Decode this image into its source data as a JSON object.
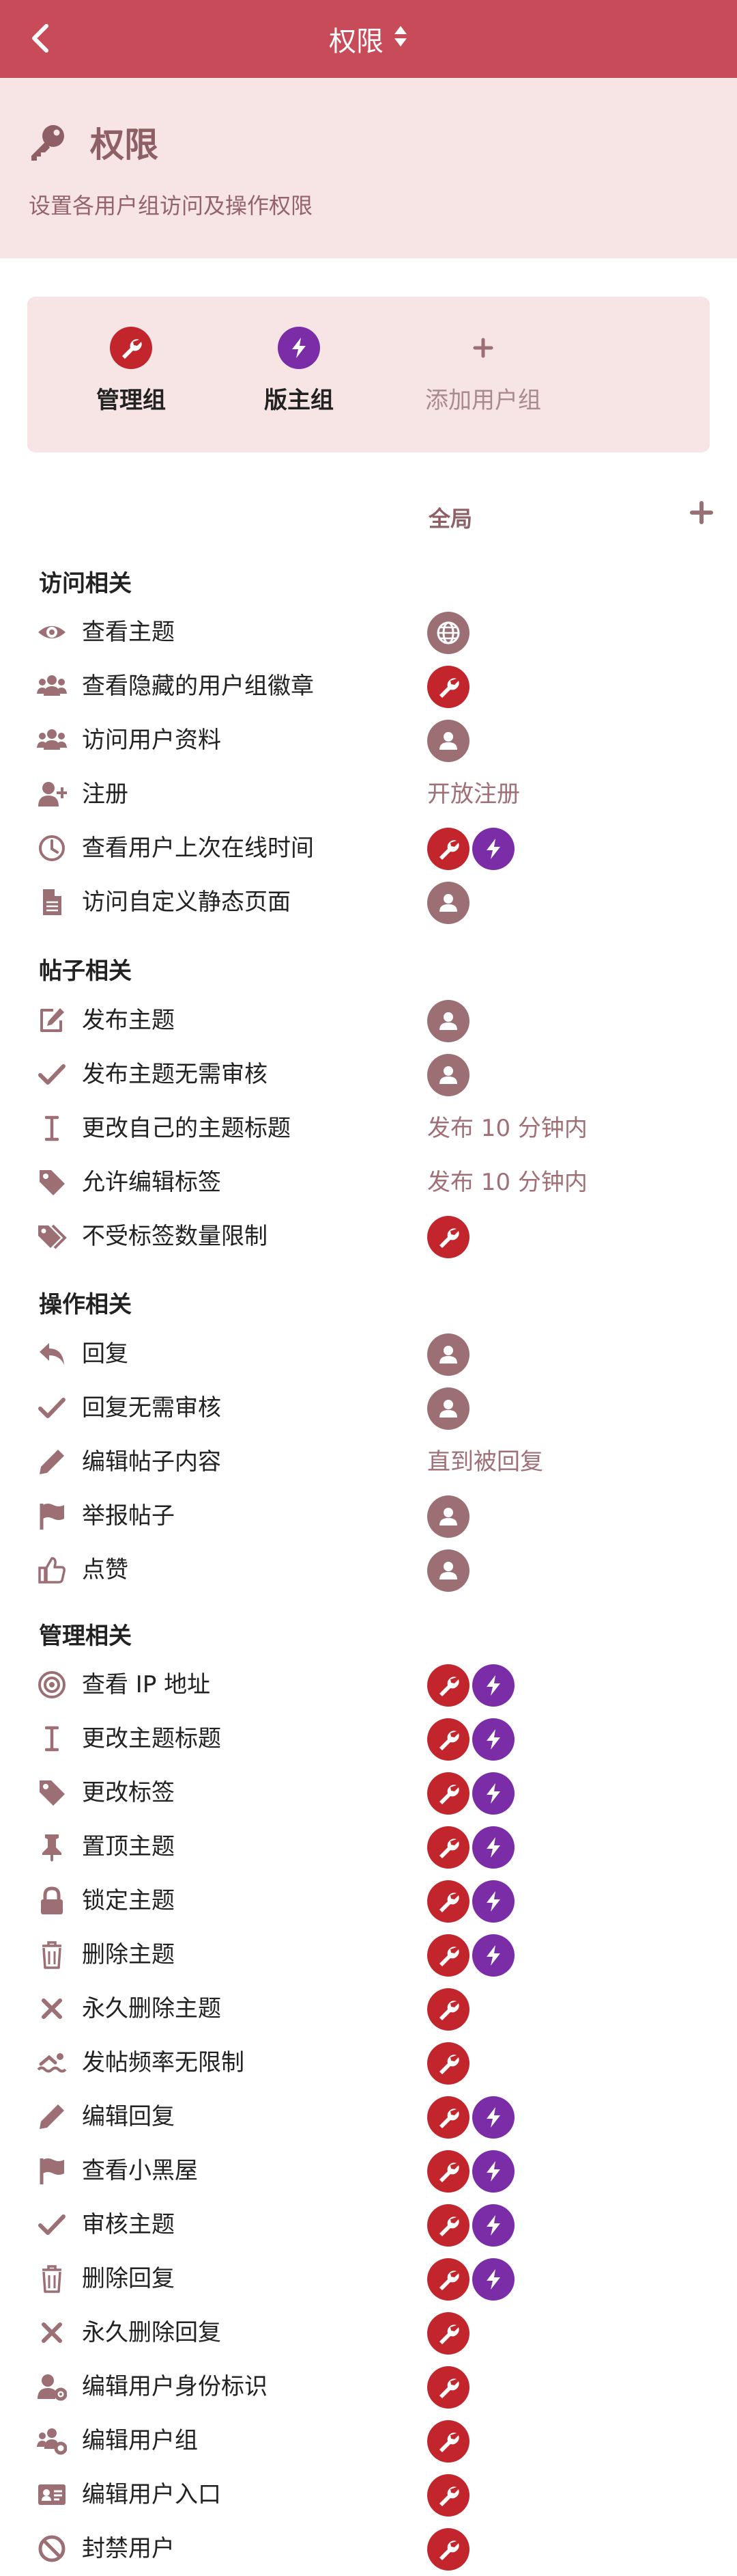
{
  "header": {
    "title": "权限"
  },
  "hero": {
    "title": "权限",
    "subtitle": "设置各用户组访问及操作权限"
  },
  "groups": [
    {
      "label": "管理组",
      "icon": "wrench-icon",
      "color": "#c2262c"
    },
    {
      "label": "版主组",
      "icon": "bolt-icon",
      "color": "#7b2da8"
    },
    {
      "label": "添加用户组",
      "icon": "plus-icon"
    }
  ],
  "column_header": "全局",
  "sections": [
    {
      "title": "访问相关",
      "rows": [
        {
          "label": "查看主题",
          "icon": "eye-icon",
          "value": [
            "globe"
          ]
        },
        {
          "label": "查看隐藏的用户组徽章",
          "icon": "users-icon",
          "value": [
            "admin"
          ]
        },
        {
          "label": "访问用户资料",
          "icon": "users-icon",
          "value": [
            "member"
          ]
        },
        {
          "label": "注册",
          "icon": "user-plus-icon",
          "text": "开放注册"
        },
        {
          "label": "查看用户上次在线时间",
          "icon": "clock-icon",
          "value": [
            "admin",
            "mod"
          ]
        },
        {
          "label": "访问自定义静态页面",
          "icon": "file-icon",
          "value": [
            "member"
          ]
        }
      ]
    },
    {
      "title": "帖子相关",
      "rows": [
        {
          "label": "发布主题",
          "icon": "edit-icon",
          "value": [
            "member"
          ]
        },
        {
          "label": "发布主题无需审核",
          "icon": "check-icon",
          "value": [
            "member"
          ]
        },
        {
          "label": "更改自己的主题标题",
          "icon": "i-cursor-icon",
          "text": "发布 10 分钟内"
        },
        {
          "label": "允许编辑标签",
          "icon": "tag-icon",
          "text": "发布 10 分钟内"
        },
        {
          "label": "不受标签数量限制",
          "icon": "tags-icon",
          "value": [
            "admin"
          ]
        }
      ]
    },
    {
      "title": "操作相关",
      "rows": [
        {
          "label": "回复",
          "icon": "reply-icon",
          "value": [
            "member"
          ]
        },
        {
          "label": "回复无需审核",
          "icon": "check-icon",
          "value": [
            "member"
          ]
        },
        {
          "label": "编辑帖子内容",
          "icon": "pencil-icon",
          "text": "直到被回复"
        },
        {
          "label": "举报帖子",
          "icon": "flag-icon",
          "value": [
            "member"
          ]
        },
        {
          "label": "点赞",
          "icon": "thumbs-up-icon",
          "value": [
            "member"
          ]
        }
      ]
    },
    {
      "title": "管理相关",
      "rows": [
        {
          "label": "查看 IP 地址",
          "icon": "target-icon",
          "value": [
            "admin",
            "mod"
          ]
        },
        {
          "label": "更改主题标题",
          "icon": "i-cursor-icon",
          "value": [
            "admin",
            "mod"
          ]
        },
        {
          "label": "更改标签",
          "icon": "tag-icon",
          "value": [
            "admin",
            "mod"
          ]
        },
        {
          "label": "置顶主题",
          "icon": "pin-icon",
          "value": [
            "admin",
            "mod"
          ]
        },
        {
          "label": "锁定主题",
          "icon": "lock-icon",
          "value": [
            "admin",
            "mod"
          ]
        },
        {
          "label": "删除主题",
          "icon": "trash-icon",
          "value": [
            "admin",
            "mod"
          ]
        },
        {
          "label": "永久删除主题",
          "icon": "times-icon",
          "value": [
            "admin"
          ]
        },
        {
          "label": "发帖频率无限制",
          "icon": "swimmer-icon",
          "value": [
            "admin"
          ]
        },
        {
          "label": "编辑回复",
          "icon": "pencil-icon",
          "value": [
            "admin",
            "mod"
          ]
        },
        {
          "label": "查看小黑屋",
          "icon": "flag-icon",
          "value": [
            "admin",
            "mod"
          ]
        },
        {
          "label": "审核主题",
          "icon": "check-icon",
          "value": [
            "admin",
            "mod"
          ]
        },
        {
          "label": "删除回复",
          "icon": "trash-icon",
          "value": [
            "admin",
            "mod"
          ]
        },
        {
          "label": "永久删除回复",
          "icon": "times-icon",
          "value": [
            "admin"
          ]
        },
        {
          "label": "编辑用户身份标识",
          "icon": "user-cog-icon",
          "value": [
            "admin"
          ]
        },
        {
          "label": "编辑用户组",
          "icon": "users-cog-icon",
          "value": [
            "admin"
          ]
        },
        {
          "label": "编辑用户入口",
          "icon": "id-card-icon",
          "value": [
            "admin"
          ]
        },
        {
          "label": "封禁用户",
          "icon": "ban-icon",
          "value": [
            "admin"
          ]
        }
      ]
    }
  ],
  "colors": {
    "header": "#c84b59",
    "hero_bg": "#f7e4e5",
    "admin": "#c2262c",
    "mod": "#7b2da8",
    "member": "#9b6f74",
    "icon": "#9b6f74"
  }
}
